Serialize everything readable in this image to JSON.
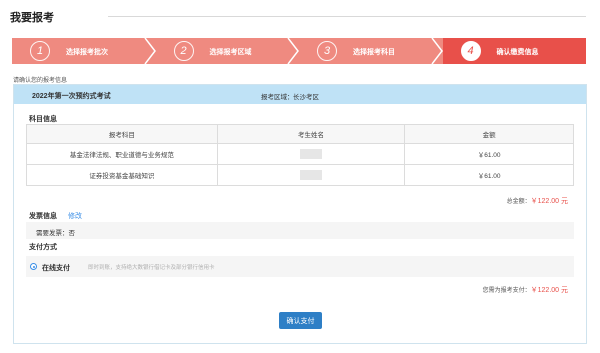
{
  "page": {
    "title": "我要报考"
  },
  "steps": [
    {
      "number": "1",
      "label": "选择报考批次"
    },
    {
      "number": "2",
      "label": "选择报考区域"
    },
    {
      "number": "3",
      "label": "选择报考科目"
    },
    {
      "number": "4",
      "label": "确认缴费信息"
    }
  ],
  "colors": {
    "step_active": "#e8504a",
    "step_inactive": "#ef8a80",
    "exam_bar": "#bfe2f6",
    "price": "#e8504a",
    "button": "#2e7fc6",
    "link": "#3a8ee6"
  },
  "hint": "请确认您的报考信息",
  "exam": {
    "name": "2022年第一次预约式考试",
    "area_label": "报考区域：",
    "area_value": "长沙考区"
  },
  "subjects": {
    "title": "科目信息",
    "columns": [
      "报考科目",
      "考生姓名",
      "金额"
    ],
    "rows": [
      {
        "subject": "基金法律法规、职业道德与业务规范",
        "amount": "￥61.00"
      },
      {
        "subject": "证券投资基金基础知识",
        "amount": "￥61.00"
      }
    ]
  },
  "total": {
    "label": "总金额：",
    "value": "￥122.00 元"
  },
  "invoice": {
    "title": "发票信息",
    "edit_label": "修改",
    "need_label": "需要发票：否"
  },
  "payment": {
    "title": "支付方式",
    "method_label": "在线支付",
    "method_desc": "即时到账，支持绝大数银行借记卡及部分银行信用卡"
  },
  "due": {
    "label": "您需为报考支付：",
    "value": "￥122.00 元"
  },
  "confirm_button": "确认支付"
}
